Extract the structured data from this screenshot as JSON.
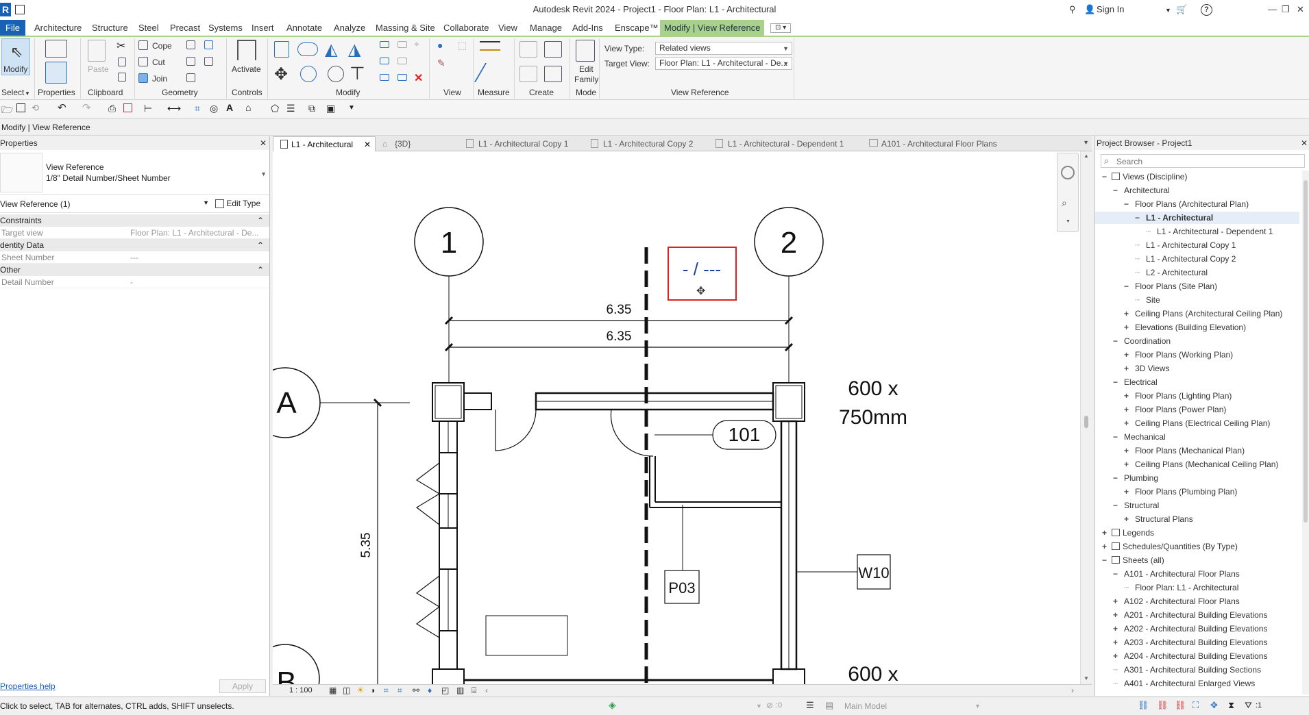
{
  "app": {
    "title": "Autodesk Revit 2024 - Project1 - Floor Plan: L1 - Architectural",
    "logo": "R",
    "sign_in": "Sign In",
    "accent_color": "#a9d18e",
    "brand_color": "#1861b4"
  },
  "menu": {
    "file": "File",
    "items": [
      "Architecture",
      "Structure",
      "Steel",
      "Precast",
      "Systems",
      "Insert",
      "Annotate",
      "Analyze",
      "Massing & Site",
      "Collaborate",
      "View",
      "Manage",
      "Add-Ins",
      "Enscape™",
      "Modify | View Reference"
    ]
  },
  "ribbon": {
    "modify": "Modify",
    "select": "Select",
    "properties": "Properties",
    "paste": "Paste",
    "clipboard": "Clipboard",
    "cope": "Cope",
    "cut": "Cut",
    "join": "Join",
    "geometry": "Geometry",
    "activate": "Activate",
    "controls": "Controls",
    "modify_group": "Modify",
    "view_group": "View",
    "measure_group": "Measure",
    "create_group": "Create",
    "edit_family_1": "Edit",
    "edit_family_2": "Family",
    "mode_group": "Mode",
    "view_type_label": "View Type:",
    "view_type_value": "Related views",
    "target_view_label": "Target View:",
    "target_view_value": "Floor Plan: L1 - Architectural - De...",
    "view_reference_group": "View Reference"
  },
  "options_bar": {
    "context": "Modify | View Reference"
  },
  "properties": {
    "title": "Properties",
    "type_name_1": "View Reference",
    "type_name_2": "1/8\" Detail Number/Sheet Number",
    "selector": "View Reference (1)",
    "edit_type": "Edit Type",
    "groups": {
      "constraints": "Constraints",
      "identity": "dentity Data",
      "other": "Other"
    },
    "rows": {
      "target_view_key": "Target view",
      "target_view_val": "Floor Plan: L1 - Architectural - De...",
      "sheet_number_key": "Sheet Number",
      "sheet_number_val": "---",
      "detail_number_key": "Detail Number",
      "detail_number_val": "-"
    },
    "help": "Properties help",
    "apply": "Apply"
  },
  "tabs": [
    "L1 - Architectural",
    "{3D}",
    "L1 - Architectural Copy 1",
    "L1 - Architectural Copy 2",
    "L1 - Architectural - Dependent 1",
    "A101 - Architectural Floor Plans"
  ],
  "drawing": {
    "grid_1": "1",
    "grid_2": "2",
    "grid_a": "A",
    "grid_b": "B",
    "dim_top_1": "6.35",
    "dim_top_2": "6.35",
    "dim_left": "5.35",
    "column_size_1": "600 x",
    "column_size_2": "750mm",
    "column_size_3": "600 x",
    "room_tag": "101",
    "tag_p03": "P03",
    "tag_w10": "W10",
    "view_reference": "- / ---"
  },
  "view_control": {
    "scale": "1 : 100"
  },
  "project_browser": {
    "title": "Project Browser - Project1",
    "search_placeholder": "Search",
    "items": [
      {
        "label": "Views (Discipline)",
        "level": 0,
        "sign": "−"
      },
      {
        "label": "Architectural",
        "level": 1,
        "sign": "−"
      },
      {
        "label": "Floor Plans (Architectural Plan)",
        "level": 2,
        "sign": "−"
      },
      {
        "label": "L1 - Architectural",
        "level": 3,
        "sign": "−",
        "selected": true
      },
      {
        "label": "L1 - Architectural - Dependent 1",
        "level": 4,
        "sign": ""
      },
      {
        "label": "L1 - Architectural Copy 1",
        "level": 3,
        "sign": ""
      },
      {
        "label": "L1 - Architectural Copy 2",
        "level": 3,
        "sign": ""
      },
      {
        "label": "L2 - Architectural",
        "level": 3,
        "sign": ""
      },
      {
        "label": "Floor Plans (Site Plan)",
        "level": 2,
        "sign": "−"
      },
      {
        "label": "Site",
        "level": 3,
        "sign": ""
      },
      {
        "label": "Ceiling Plans (Architectural Ceiling Plan)",
        "level": 2,
        "sign": "+"
      },
      {
        "label": "Elevations (Building Elevation)",
        "level": 2,
        "sign": "+"
      },
      {
        "label": "Coordination",
        "level": 1,
        "sign": "−"
      },
      {
        "label": "Floor Plans (Working Plan)",
        "level": 2,
        "sign": "+"
      },
      {
        "label": "3D Views",
        "level": 2,
        "sign": "+"
      },
      {
        "label": "Electrical",
        "level": 1,
        "sign": "−"
      },
      {
        "label": "Floor Plans (Lighting Plan)",
        "level": 2,
        "sign": "+"
      },
      {
        "label": "Floor Plans (Power Plan)",
        "level": 2,
        "sign": "+"
      },
      {
        "label": "Ceiling Plans (Electrical Ceiling Plan)",
        "level": 2,
        "sign": "+"
      },
      {
        "label": "Mechanical",
        "level": 1,
        "sign": "−"
      },
      {
        "label": "Floor Plans (Mechanical Plan)",
        "level": 2,
        "sign": "+"
      },
      {
        "label": "Ceiling Plans (Mechanical Ceiling Plan)",
        "level": 2,
        "sign": "+"
      },
      {
        "label": "Plumbing",
        "level": 1,
        "sign": "−"
      },
      {
        "label": "Floor Plans (Plumbing Plan)",
        "level": 2,
        "sign": "+"
      },
      {
        "label": "Structural",
        "level": 1,
        "sign": "−"
      },
      {
        "label": "Structural Plans",
        "level": 2,
        "sign": "+"
      },
      {
        "label": "Legends",
        "level": 0,
        "sign": "+"
      },
      {
        "label": "Schedules/Quantities (By Type)",
        "level": 0,
        "sign": "+"
      },
      {
        "label": "Sheets (all)",
        "level": 0,
        "sign": "−"
      },
      {
        "label": "A101 - Architectural Floor Plans",
        "level": 1,
        "sign": "−"
      },
      {
        "label": "Floor Plan: L1 - Architectural",
        "level": 2,
        "sign": ""
      },
      {
        "label": "A102 - Architectural Floor Plans",
        "level": 1,
        "sign": "+"
      },
      {
        "label": "A201 - Architectural Building Elevations",
        "level": 1,
        "sign": "+"
      },
      {
        "label": "A202 - Architectural Building Elevations",
        "level": 1,
        "sign": "+"
      },
      {
        "label": "A203 - Architectural Building Elevations",
        "level": 1,
        "sign": "+"
      },
      {
        "label": "A204 - Architectural Building Elevations",
        "level": 1,
        "sign": "+"
      },
      {
        "label": "A301 - Architectural Building Sections",
        "level": 1,
        "sign": ""
      },
      {
        "label": "A401 - Architectural Enlarged Views",
        "level": 1,
        "sign": ""
      }
    ]
  },
  "status": {
    "hint": "Click to select, TAB for alternates, CTRL adds, SHIFT unselects.",
    "zero": ":0",
    "model": "Main Model",
    "filter": ":1"
  }
}
